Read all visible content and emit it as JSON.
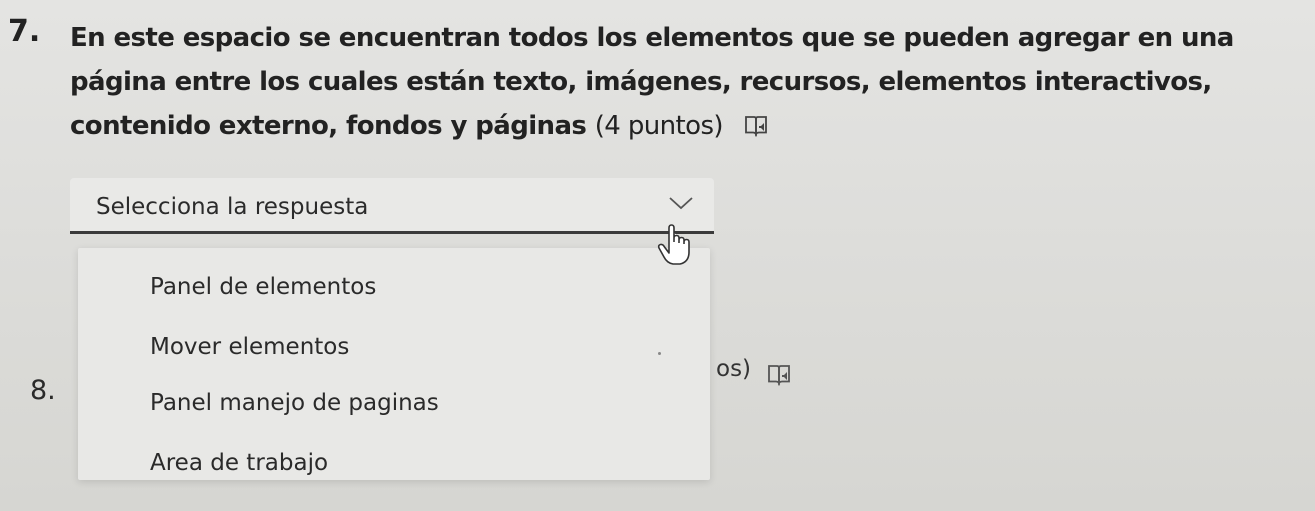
{
  "question7": {
    "number": "7.",
    "text": "En este espacio se encuentran todos los elementos que se pueden agregar en una página entre los cuales están texto, imágenes, recursos, elementos interactivos, contenido externo, fondos y páginas",
    "points": "(4 puntos)",
    "icon": "immersive-reader-icon"
  },
  "select": {
    "placeholder": "Selecciona la respuesta",
    "icon": "chevron-down-icon"
  },
  "options": [
    "Panel de elementos",
    "Mover elementos",
    "Panel manejo de paginas",
    "Area de trabajo"
  ],
  "question8": {
    "number": "8.",
    "tail": "os)",
    "icon": "immersive-reader-icon"
  }
}
